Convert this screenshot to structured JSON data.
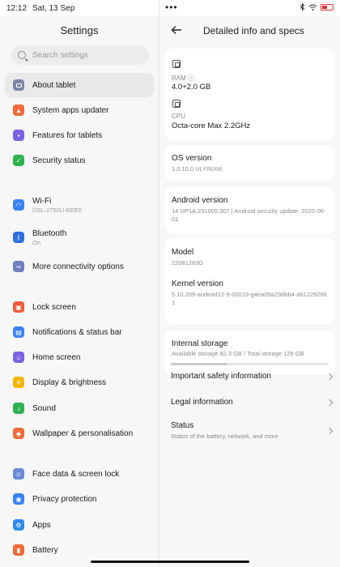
{
  "status_bar": {
    "time": "12:12",
    "date": "Sat, 13 Sep",
    "dots": "•••"
  },
  "left": {
    "title": "Settings",
    "search_placeholder": "Search settings",
    "items": [
      {
        "label": "About tablet",
        "icon": "tablet-icon",
        "color": "#7a87a8"
      },
      {
        "label": "System apps updater",
        "icon": "arrow-up-icon",
        "color": "#f06a3a"
      },
      {
        "label": "Features for tablets",
        "icon": "grid-icon",
        "color": "#7b63e0"
      },
      {
        "label": "Security status",
        "icon": "shield-check-icon",
        "color": "#2db24f"
      },
      {
        "label": "Wi-Fi",
        "sub": "DSL-2750U-EEE0",
        "icon": "wifi-icon",
        "color": "#3b82f6"
      },
      {
        "label": "Bluetooth",
        "sub": "On",
        "icon": "bluetooth-icon",
        "color": "#2f6fe0"
      },
      {
        "label": "More connectivity options",
        "icon": "connectivity-icon",
        "color": "#6f7fbf"
      },
      {
        "label": "Lock screen",
        "icon": "lock-icon",
        "color": "#ef5a3b"
      },
      {
        "label": "Notifications & status bar",
        "icon": "notification-icon",
        "color": "#3b82f6"
      },
      {
        "label": "Home screen",
        "icon": "home-icon",
        "color": "#7b63e0"
      },
      {
        "label": "Display & brightness",
        "icon": "sun-icon",
        "color": "#f5b400"
      },
      {
        "label": "Sound",
        "icon": "sound-icon",
        "color": "#2db24f"
      },
      {
        "label": "Wallpaper & personalisation",
        "icon": "palette-icon",
        "color": "#f06a3a"
      },
      {
        "label": "Face data & screen lock",
        "icon": "face-icon",
        "color": "#6a8ad8"
      },
      {
        "label": "Privacy protection",
        "icon": "privacy-icon",
        "color": "#3b82f6"
      },
      {
        "label": "Apps",
        "icon": "apps-icon",
        "color": "#2f8af0"
      },
      {
        "label": "Battery",
        "icon": "battery-icon",
        "color": "#f06a3a"
      }
    ]
  },
  "right": {
    "title": "Detailed info and specs",
    "ram_label": "RAM ⓘ",
    "ram_value": "4.0+2.0 GB",
    "cpu_label": "CPU",
    "cpu_value": "Octa-core Max 2.2GHz",
    "os_title": "OS version",
    "os_value": "1.0.10.0.ULYINXM",
    "android_title": "Android version",
    "android_value": "14 UP1A.231005.007 | Android security update: 2025-06-01",
    "model_title": "Model",
    "model_value": "22081283G",
    "kernel_title": "Kernel version",
    "kernel_value": "5.10.209-android12-9-00019-g4ea09a298bb4-ab12292661",
    "storage_title": "Internal storage",
    "storage_value": "Available storage  82.3 GB / Total storage  128 GB",
    "storage_used_fraction": 0.36,
    "safety_label": "Important safety information",
    "legal_label": "Legal information",
    "status_label": "Status",
    "status_sub": "Status of the battery, network, and more"
  }
}
